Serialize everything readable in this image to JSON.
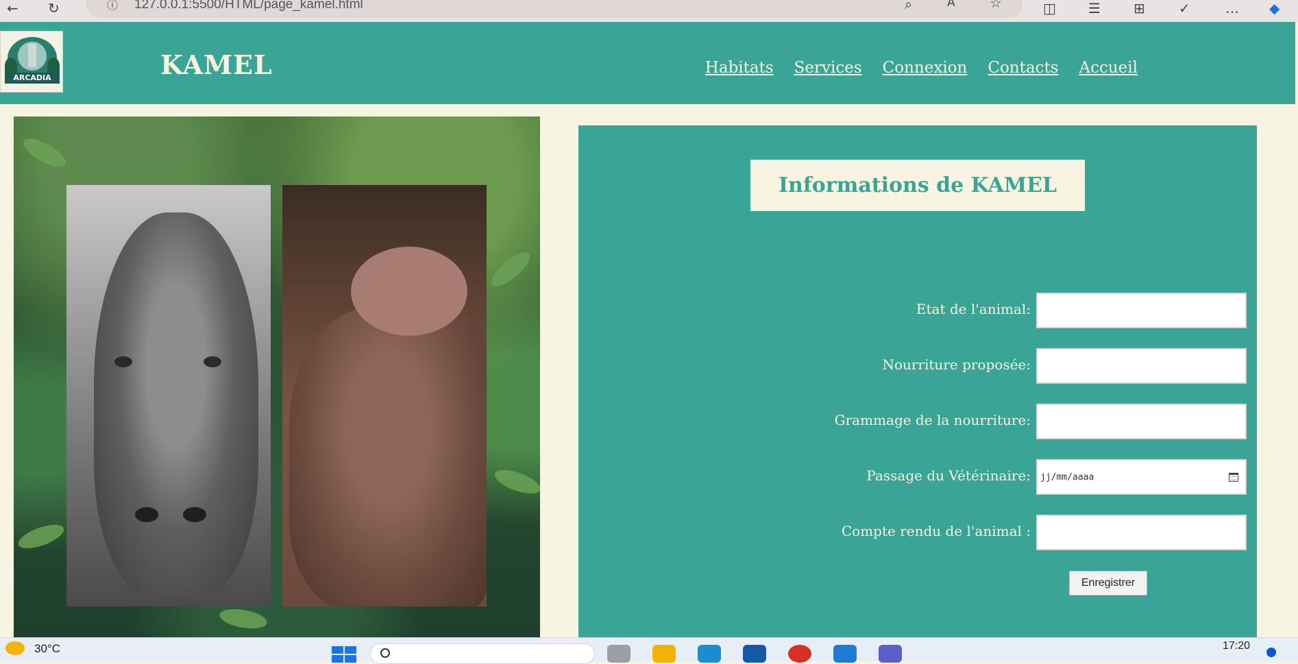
{
  "browser": {
    "url": "127.0.0.1:5500/HTML/page_kamel.html"
  },
  "header": {
    "logo_text": "ARCADIA",
    "site_title": "KAMEL",
    "nav": [
      {
        "label": "Habitats"
      },
      {
        "label": "Services"
      },
      {
        "label": "Connexion"
      },
      {
        "label": "Contacts"
      },
      {
        "label": "Accueil"
      }
    ]
  },
  "panel": {
    "title": "Informations de KAMEL",
    "fields": [
      {
        "label": "Etat de l'animal:",
        "value": ""
      },
      {
        "label": "Nourriture proposée:",
        "value": ""
      },
      {
        "label": "Grammage de la nourriture:",
        "value": ""
      },
      {
        "label": "Passage du Vétérinaire:",
        "placeholder": "jj/mm/aaaa"
      },
      {
        "label": "Compte rendu de l'animal :",
        "value": ""
      }
    ],
    "save_label": "Enregistrer"
  },
  "taskbar": {
    "temperature": "30°C",
    "clock": "17:20"
  },
  "colors": {
    "teal": "#3aa597",
    "cream": "#f7f4e1"
  }
}
